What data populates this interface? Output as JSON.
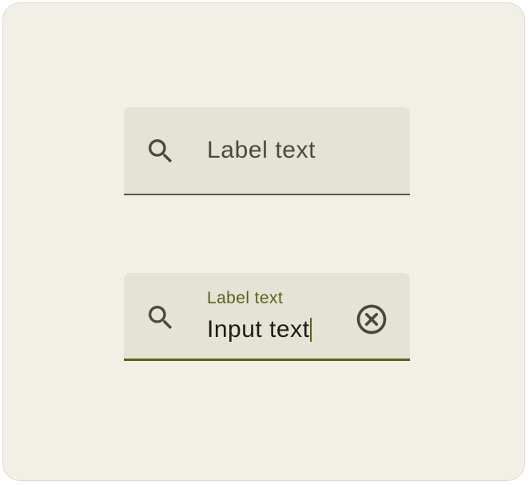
{
  "fields": [
    {
      "state": "default",
      "label": "Label text",
      "leading_icon": "search-icon"
    },
    {
      "state": "focused",
      "label": "Label text",
      "value": "Input text",
      "leading_icon": "search-icon",
      "trailing_icon": "clear-icon"
    }
  ],
  "colors": {
    "canvas": "#f2f0e6",
    "container": "#e4e3d6",
    "active_indicator_default": "#5a5a4a",
    "active_indicator_focused": "#5e6018",
    "label_default": "#494a3d",
    "label_focused": "#5e6018",
    "input_text": "#1c1c14"
  }
}
